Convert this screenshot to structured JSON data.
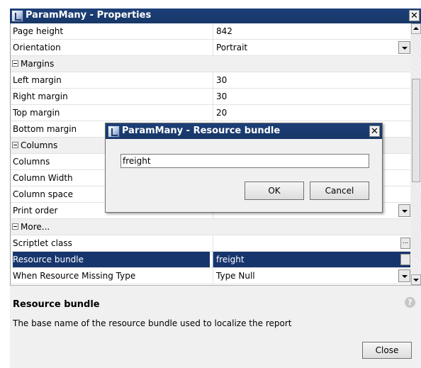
{
  "window": {
    "title": "ParamMany - Properties",
    "close_glyph": "✕",
    "app_icon": "report-icon"
  },
  "properties": {
    "rows": [
      {
        "kind": "prop",
        "name": "Page height",
        "value": "842"
      },
      {
        "kind": "prop",
        "name": "Orientation",
        "value": "Portrait",
        "editor": "dropdown"
      },
      {
        "kind": "category",
        "name": "Margins"
      },
      {
        "kind": "prop",
        "name": "Left margin",
        "value": "30"
      },
      {
        "kind": "prop",
        "name": "Right margin",
        "value": "30"
      },
      {
        "kind": "prop",
        "name": "Top margin",
        "value": "20"
      },
      {
        "kind": "prop",
        "name": "Bottom margin",
        "value": ""
      },
      {
        "kind": "category",
        "name": "Columns"
      },
      {
        "kind": "prop",
        "name": "Columns",
        "value": ""
      },
      {
        "kind": "prop",
        "name": "Column Width",
        "value": ""
      },
      {
        "kind": "prop",
        "name": "Column space",
        "value": ""
      },
      {
        "kind": "prop",
        "name": "Print order",
        "value": "",
        "editor": "dropdown"
      },
      {
        "kind": "category",
        "name": "More..."
      },
      {
        "kind": "prop",
        "name": "Scriptlet class",
        "value": "",
        "editor": "ellipsis"
      },
      {
        "kind": "prop",
        "name": "Resource bundle",
        "value": "freight",
        "editor": "ellipsis",
        "selected": true
      },
      {
        "kind": "prop",
        "name": "When Resource Missing Type",
        "value": "Type Null",
        "editor": "dropdown"
      }
    ]
  },
  "description": {
    "title": "Resource bundle",
    "text": "The base name of the resource bundle used to localize the report",
    "help_glyph": "?",
    "close_label": "Close"
  },
  "dialog": {
    "title": "ParamMany - Resource bundle",
    "close_glyph": "✕",
    "input_value": "freight",
    "ok_label": "OK",
    "cancel_label": "Cancel"
  },
  "colors": {
    "title_bar": "#173767",
    "selection": "#17356d",
    "background": "#f0f0f0"
  }
}
